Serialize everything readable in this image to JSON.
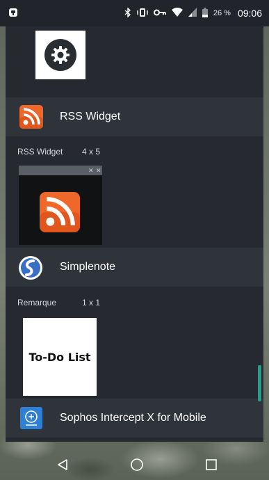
{
  "status_bar": {
    "battery_percent": "26 %",
    "time": "09:06",
    "icons": [
      "notification-icon",
      "bluetooth-icon",
      "vibrate-icon",
      "vpn-key-icon",
      "wifi-icon",
      "signal-icon",
      "battery-icon"
    ]
  },
  "settings_widget": {
    "icon": "gear-icon"
  },
  "apps": [
    {
      "name": "RSS Widget",
      "icon": "rss-icon",
      "widget": {
        "name": "RSS Widget",
        "size": "4 x 5"
      }
    },
    {
      "name": "Simplenote",
      "icon": "simplenote-icon",
      "widget": {
        "name": "Remarque",
        "size": "1 x 1",
        "preview_text": "To-Do List"
      }
    },
    {
      "name": "Sophos Intercept X for Mobile",
      "icon": "sophos-icon"
    }
  ],
  "nav_bar": {
    "buttons": [
      "back-button",
      "home-button",
      "recents-button"
    ]
  },
  "colors": {
    "panel_bg": "#262a30",
    "header_bg": "#2f343a",
    "rss_orange": "#f0672a",
    "simplenote_blue": "#3a6fc4",
    "sophos_blue": "#2f7fd3",
    "scroll_accent": "#1aa38a"
  }
}
